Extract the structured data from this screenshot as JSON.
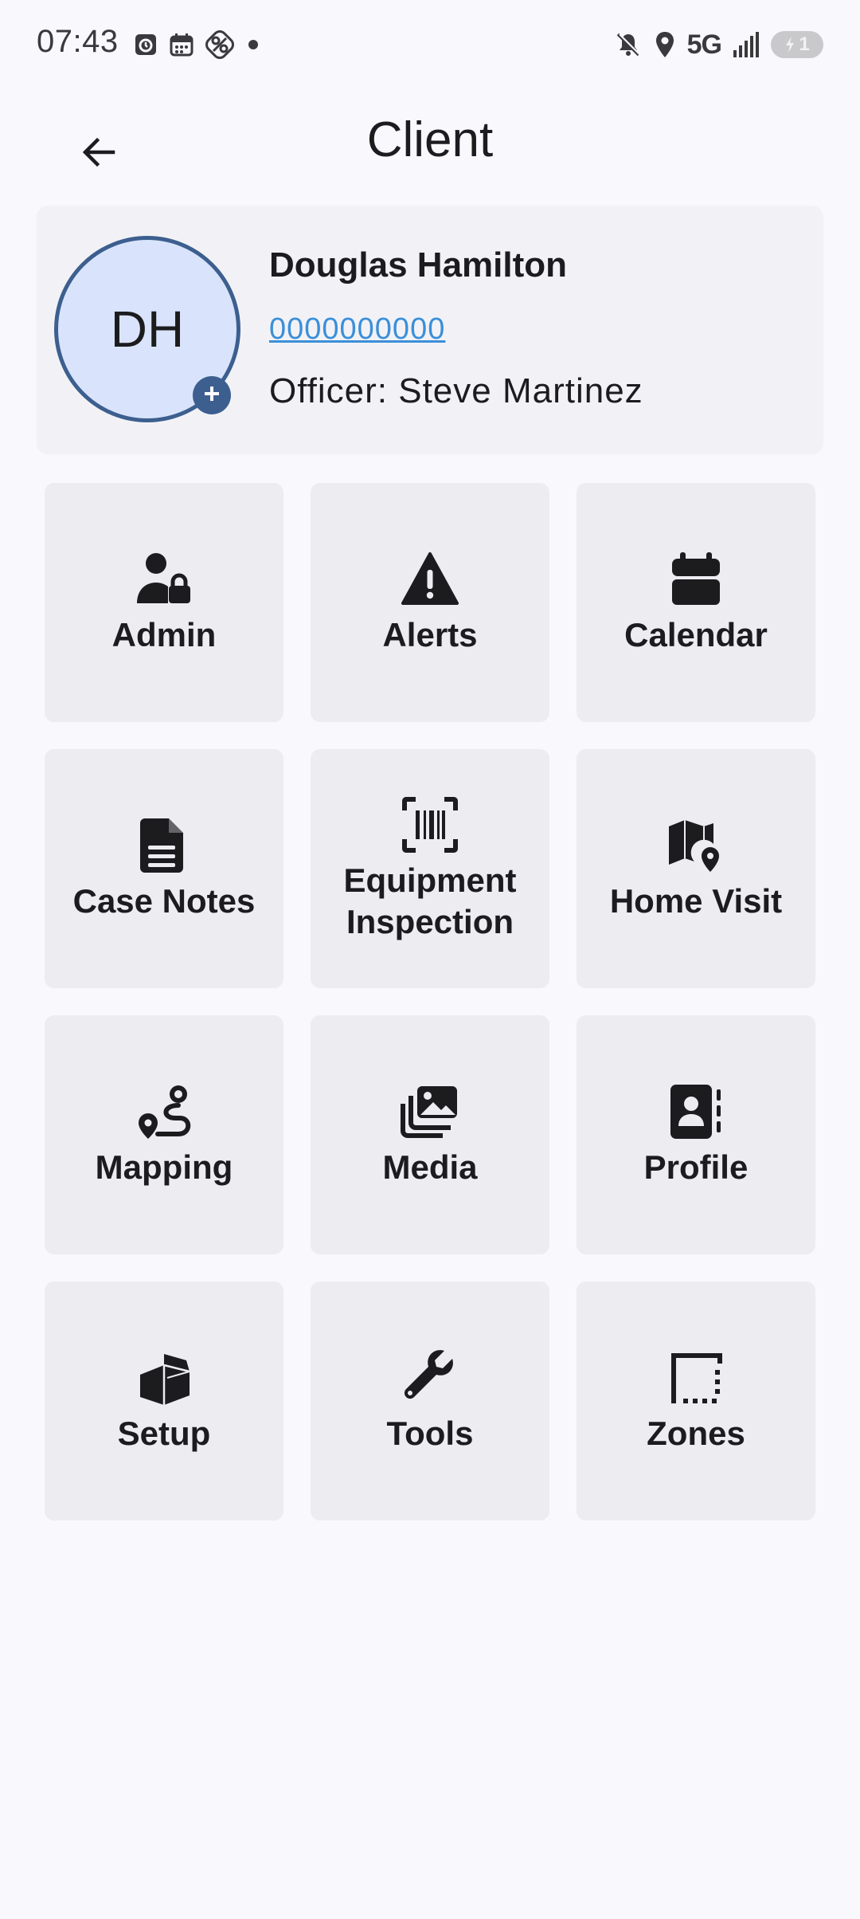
{
  "status_bar": {
    "time": "07:43",
    "network": "5G",
    "battery": "1",
    "left_icons": [
      "alarm-icon",
      "calendar-notification-icon",
      "vpn-icon",
      "notification-dot-icon"
    ],
    "right_icons": [
      "mute-icon",
      "location-icon",
      "signal-icon",
      "battery-icon"
    ]
  },
  "app_bar": {
    "title": "Client",
    "back_icon": "arrow-left-icon"
  },
  "client": {
    "initials": "DH",
    "name": "Douglas Hamilton",
    "phone": "0000000000",
    "officer": "Officer: Steve Martinez"
  },
  "tiles": [
    {
      "label": "Admin",
      "icon": "user-lock-icon"
    },
    {
      "label": "Alerts",
      "icon": "warning-icon"
    },
    {
      "label": "Calendar",
      "icon": "calendar-icon"
    },
    {
      "label": "Case Notes",
      "icon": "document-icon"
    },
    {
      "label": "Equipment\nInspection",
      "icon": "barcode-scan-icon"
    },
    {
      "label": "Home Visit",
      "icon": "map-marker-icon"
    },
    {
      "label": "Mapping",
      "icon": "route-icon"
    },
    {
      "label": "Media",
      "icon": "photos-icon"
    },
    {
      "label": "Profile",
      "icon": "contact-card-icon"
    },
    {
      "label": "Setup",
      "icon": "box-open-icon"
    },
    {
      "label": "Tools",
      "icon": "wrench-icon"
    },
    {
      "label": "Zones",
      "icon": "border-style-icon"
    }
  ],
  "colors": {
    "background": "#f8f8fd",
    "tile": "#ececf1",
    "avatar_fill": "#d9e4fc",
    "avatar_border": "#3d5f8f",
    "link": "#3b8fd8"
  }
}
